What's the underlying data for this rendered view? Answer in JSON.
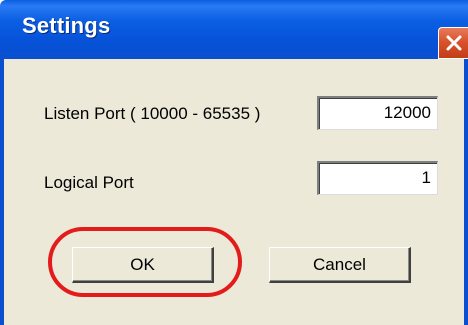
{
  "window": {
    "title": "Settings",
    "close_icon": "close-icon"
  },
  "fields": {
    "listen_port": {
      "label": "Listen Port ( 10000 - 65535 )",
      "value": "12000"
    },
    "logical_port": {
      "label": "Logical Port",
      "value": "1"
    }
  },
  "buttons": {
    "ok_label": "OK",
    "cancel_label": "Cancel"
  },
  "colors": {
    "titlebar": "#0a5fe0",
    "client_background": "#ece9d8",
    "close_button": "#d9542d",
    "highlight_outline": "#e31b1b"
  }
}
